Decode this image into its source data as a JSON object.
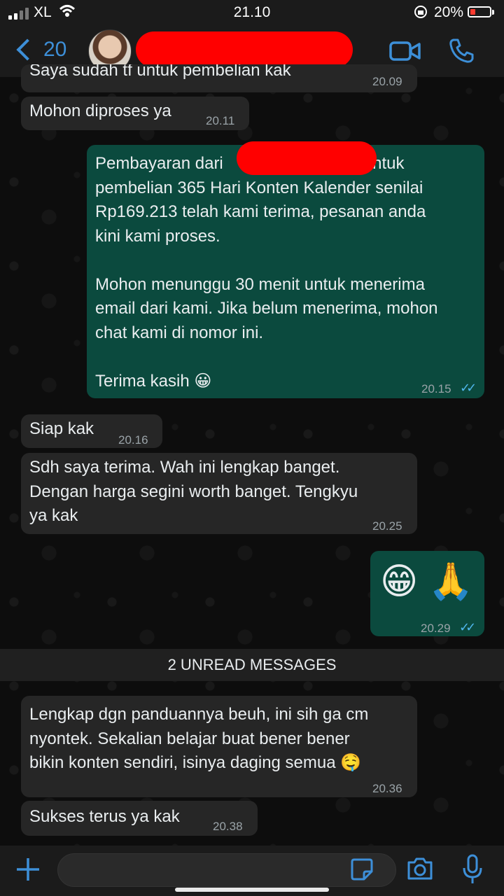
{
  "status_bar": {
    "carrier": "XL",
    "time": "21.10",
    "battery": "20%"
  },
  "header": {
    "back_count": "20"
  },
  "messages": [
    {
      "text": "Saya sudah tf untuk pembelian kak",
      "time": "20.09"
    },
    {
      "text": "Mohon diproses ya",
      "time": "20.11"
    },
    {
      "text": "Pembayaran dari                              untuk\npembelian 365 Hari Konten Kalender senilai\nRp169.213 telah kami terima, pesanan anda\nkini kami proses.\n\nMohon menunggu 30 menit untuk menerima\nemail dari kami. Jika belum menerima, mohon\nchat kami di nomor ini.\n\nTerima kasih 😀",
      "time": "20.15"
    },
    {
      "text": "Siap kak",
      "time": "20.16"
    },
    {
      "text": "Sdh saya terima. Wah ini lengkap banget.\nDengan harga segini worth banget. Tengkyu\nya kak",
      "time": "20.25"
    },
    {
      "text": "😁 🙏",
      "time": "20.29"
    },
    {
      "text": "Lengkap dgn panduannya beuh, ini sih ga cm\nnyontek. Sekalian belajar buat bener bener\nbikin konten sendiri, isinya daging semua 🤤",
      "time": "20.36"
    },
    {
      "text": "Sukses terus ya kak",
      "time": "20.38"
    }
  ],
  "unread_label": "2 UNREAD MESSAGES",
  "colors": {
    "incoming": "#262626",
    "outgoing": "#0b4a3e",
    "accent": "#3d8fd8",
    "ticks": "#4fb6ec",
    "redaction": "#ff0000"
  },
  "icons": [
    "signal-icon",
    "wifi-icon",
    "lock-rotation-icon",
    "battery-icon",
    "back-chevron-icon",
    "video-call-icon",
    "phone-icon",
    "plus-icon",
    "sticker-icon",
    "camera-icon",
    "mic-icon",
    "double-check-icon"
  ]
}
